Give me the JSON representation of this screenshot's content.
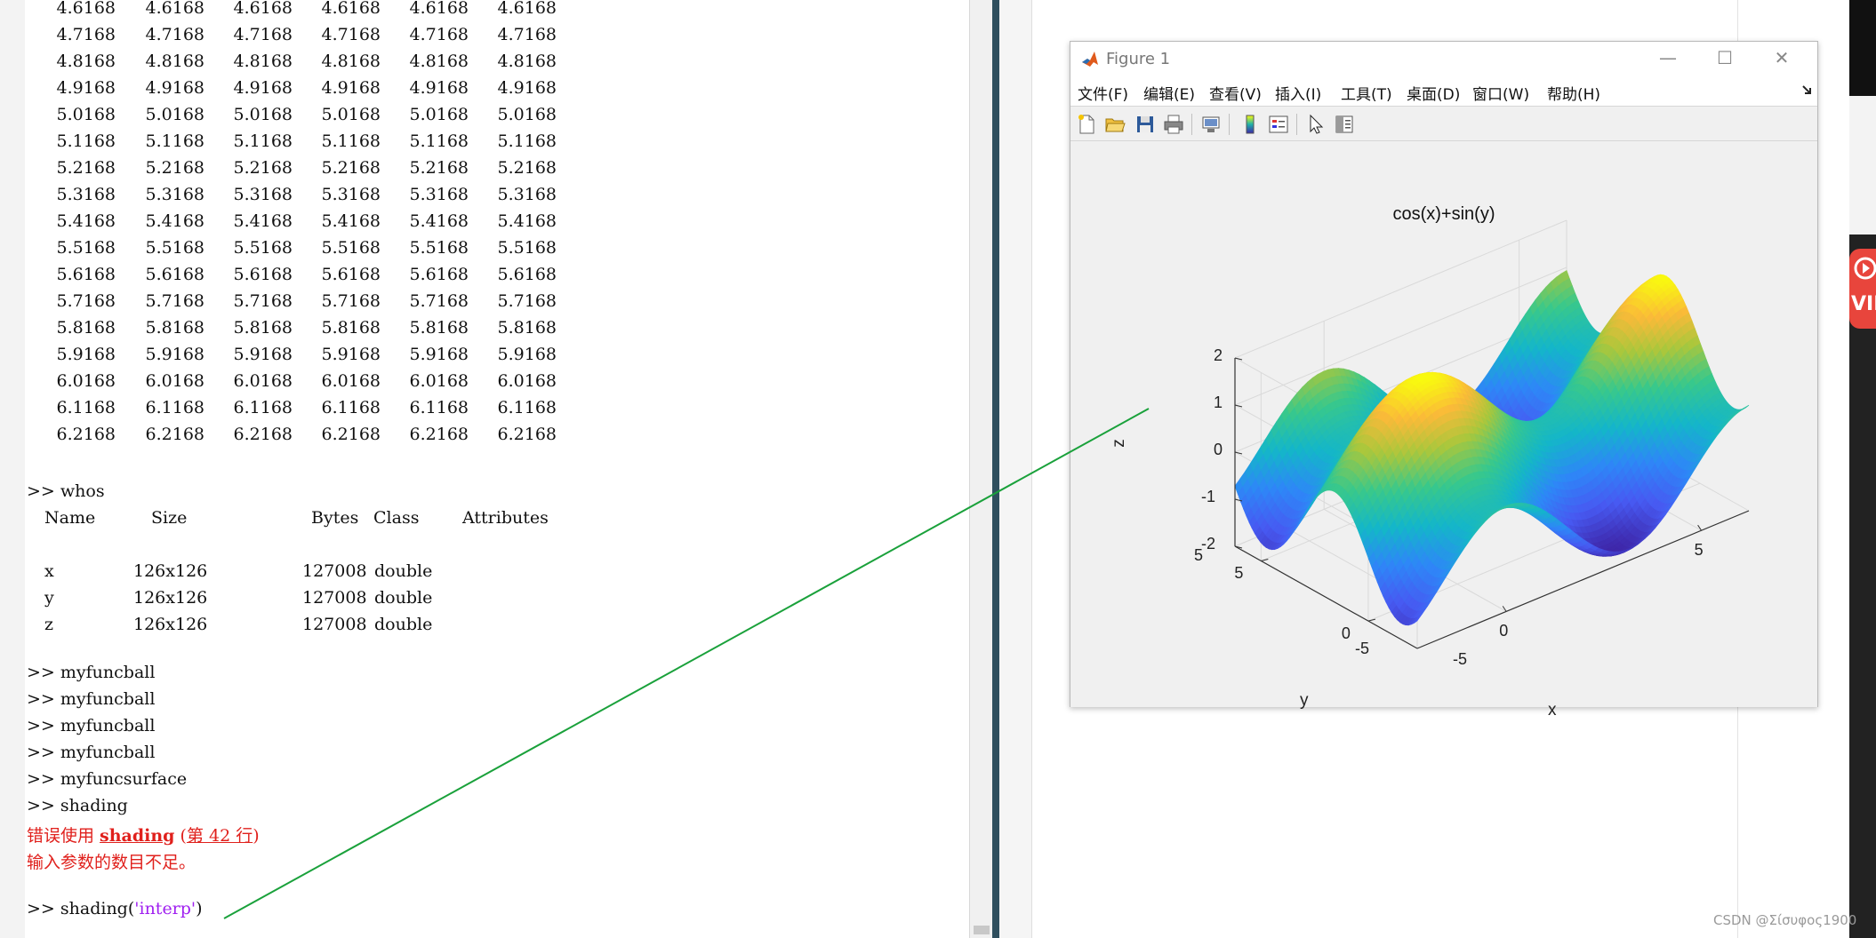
{
  "command_window": {
    "matrix_rows": [
      [
        "4.6168",
        "4.6168",
        "4.6168",
        "4.6168",
        "4.6168",
        "4.6168"
      ],
      [
        "4.7168",
        "4.7168",
        "4.7168",
        "4.7168",
        "4.7168",
        "4.7168"
      ],
      [
        "4.8168",
        "4.8168",
        "4.8168",
        "4.8168",
        "4.8168",
        "4.8168"
      ],
      [
        "4.9168",
        "4.9168",
        "4.9168",
        "4.9168",
        "4.9168",
        "4.9168"
      ],
      [
        "5.0168",
        "5.0168",
        "5.0168",
        "5.0168",
        "5.0168",
        "5.0168"
      ],
      [
        "5.1168",
        "5.1168",
        "5.1168",
        "5.1168",
        "5.1168",
        "5.1168"
      ],
      [
        "5.2168",
        "5.2168",
        "5.2168",
        "5.2168",
        "5.2168",
        "5.2168"
      ],
      [
        "5.3168",
        "5.3168",
        "5.3168",
        "5.3168",
        "5.3168",
        "5.3168"
      ],
      [
        "5.4168",
        "5.4168",
        "5.4168",
        "5.4168",
        "5.4168",
        "5.4168"
      ],
      [
        "5.5168",
        "5.5168",
        "5.5168",
        "5.5168",
        "5.5168",
        "5.5168"
      ],
      [
        "5.6168",
        "5.6168",
        "5.6168",
        "5.6168",
        "5.6168",
        "5.6168"
      ],
      [
        "5.7168",
        "5.7168",
        "5.7168",
        "5.7168",
        "5.7168",
        "5.7168"
      ],
      [
        "5.8168",
        "5.8168",
        "5.8168",
        "5.8168",
        "5.8168",
        "5.8168"
      ],
      [
        "5.9168",
        "5.9168",
        "5.9168",
        "5.9168",
        "5.9168",
        "5.9168"
      ],
      [
        "6.0168",
        "6.0168",
        "6.0168",
        "6.0168",
        "6.0168",
        "6.0168"
      ],
      [
        "6.1168",
        "6.1168",
        "6.1168",
        "6.1168",
        "6.1168",
        "6.1168"
      ],
      [
        "6.2168",
        "6.2168",
        "6.2168",
        "6.2168",
        "6.2168",
        "6.2168"
      ]
    ],
    "prompt": ">>",
    "whos_cmd": "whos",
    "whos_headers": [
      "Name",
      "Size",
      "Bytes",
      "Class",
      "Attributes"
    ],
    "whos_rows": [
      {
        "name": "x",
        "size": "126x126",
        "bytes": "127008",
        "class": "double"
      },
      {
        "name": "y",
        "size": "126x126",
        "bytes": "127008",
        "class": "double"
      },
      {
        "name": "z",
        "size": "126x126",
        "bytes": "127008",
        "class": "double"
      }
    ],
    "commands": [
      "myfuncball",
      "myfuncball",
      "myfuncball",
      "myfuncball",
      "myfuncsurface",
      "shading"
    ],
    "error": {
      "prefix": "错误使用 ",
      "function": "shading",
      "ref_open": " (",
      "ref": "第 42 行",
      "ref_close": ")",
      "message": "输入参数的数目不足。"
    },
    "last_cmd_func": "shading(",
    "last_cmd_arg": "'interp'",
    "last_cmd_close": ")"
  },
  "figure": {
    "title": "Figure 1",
    "menu": [
      "文件(F)",
      "编辑(E)",
      "查看(V)",
      "插入(I)",
      "工具(T)",
      "桌面(D)",
      "窗口(W)",
      "帮助(H)"
    ],
    "window_buttons": {
      "minimize": "—",
      "maximize": "☐",
      "close": "✕"
    },
    "toolbar_icons": [
      "new-figure-icon",
      "open-file-icon",
      "save-icon",
      "print-icon",
      "link-plot-icon",
      "colorbar-icon",
      "legend-icon",
      "select-arrow-icon",
      "property-inspector-icon"
    ]
  },
  "chart_data": {
    "type": "surface",
    "title": "cos(x)+sin(y)",
    "function": "cos(x)+sin(y)",
    "xlabel": "x",
    "ylabel": "y",
    "zlabel": "z",
    "xlim": [
      -2.2832,
      6.2168
    ],
    "ylim": [
      -2.2832,
      6.2168
    ],
    "zlim": [
      -2,
      2
    ],
    "x_ticks": [
      -5,
      0,
      5
    ],
    "y_ticks": [
      -5,
      0,
      5
    ],
    "z_ticks": [
      -2,
      -1,
      0,
      1,
      2
    ],
    "grid": true,
    "colormap": "parula",
    "shading": "interp"
  },
  "annotation": {
    "color": "#1aa13b"
  },
  "watermark": "CSDN @Σίσυφος1900"
}
